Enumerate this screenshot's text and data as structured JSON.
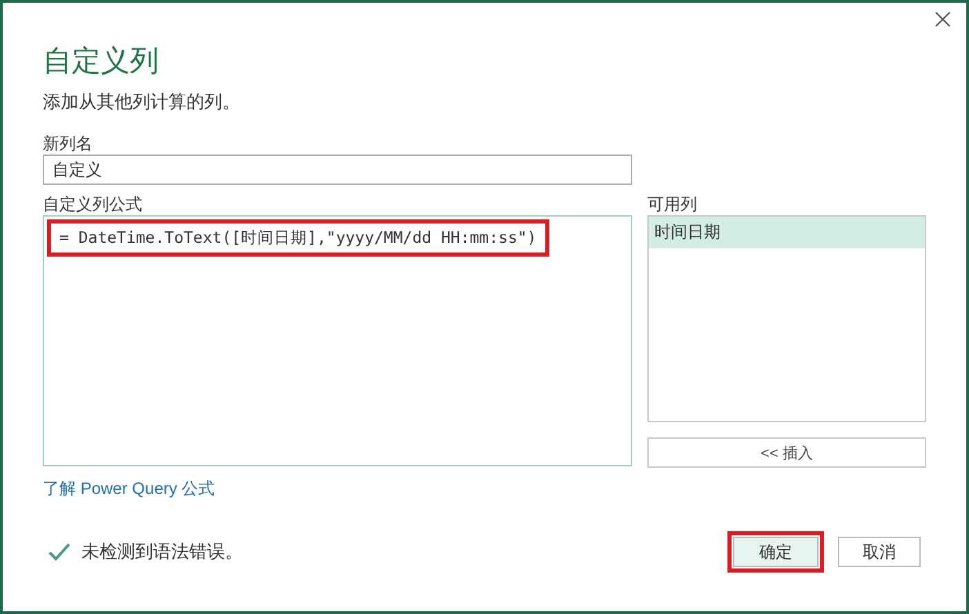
{
  "window": {
    "title": "自定义列",
    "subtitle": "添加从其他列计算的列。"
  },
  "new_column_name": {
    "label": "新列名",
    "value": "自定义"
  },
  "formula": {
    "label": "自定义列公式",
    "value": "= DateTime.ToText([时间日期],\"yyyy/MM/dd HH:mm:ss\")",
    "highlighted": true
  },
  "available_columns": {
    "label": "可用列",
    "items": [
      {
        "label": "时间日期",
        "selected": true
      }
    ],
    "insert_button": "<< 插入"
  },
  "learn_link": "了解 Power Query 公式",
  "status": {
    "kind": "ok",
    "text": "未检测到语法错误。"
  },
  "buttons": [
    {
      "label": "确定",
      "primary": true,
      "highlighted": true
    },
    {
      "label": "取消",
      "primary": false,
      "highlighted": false
    }
  ]
}
